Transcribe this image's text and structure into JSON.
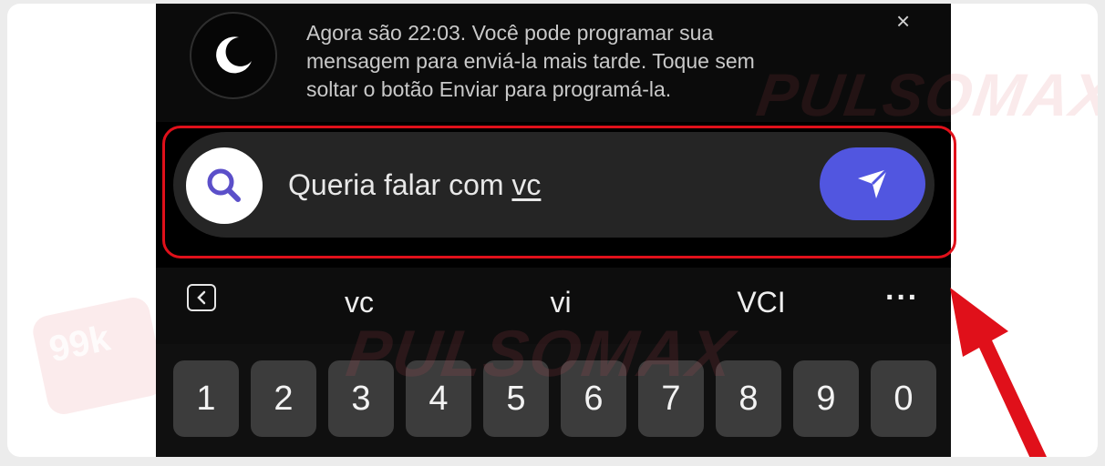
{
  "notice": {
    "text_line1": "Agora são 22:03. Você pode programar sua",
    "text_line2": "mensagem para enviá-la mais tarde. Toque sem",
    "text_line3": "soltar o botão Enviar para programá-la.",
    "close_label": "×",
    "icon": "moon-icon"
  },
  "input": {
    "text_prefix": "Queria falar com ",
    "text_underlined": "vc",
    "search_icon": "search-icon",
    "send_icon": "send-icon"
  },
  "suggestions": {
    "items": [
      "vc",
      "vi",
      "VCI"
    ],
    "more_label": "···"
  },
  "keyboard": {
    "number_keys": [
      "1",
      "2",
      "3",
      "4",
      "5",
      "6",
      "7",
      "8",
      "9",
      "0"
    ]
  },
  "watermark": {
    "text": "PULSOMAX",
    "badge": "99k"
  },
  "colors": {
    "send_button": "#5156e0",
    "highlight_frame": "#e0101a",
    "arrow": "#e0101a"
  }
}
